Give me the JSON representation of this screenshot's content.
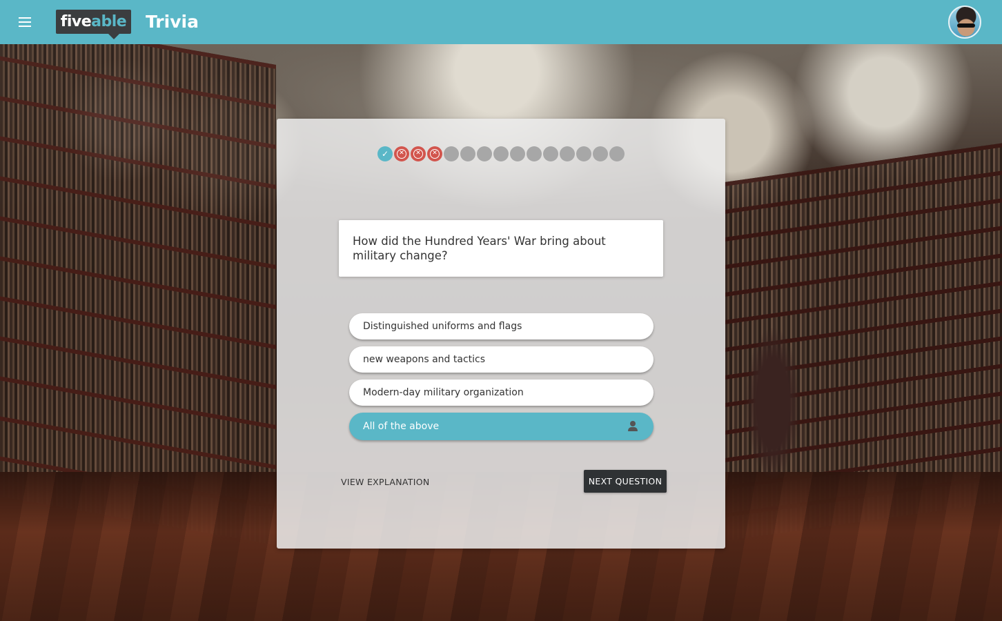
{
  "header": {
    "logo_part1": "five",
    "logo_part2": "able",
    "app_title": "Trivia",
    "bar_color": "#5ab7c7"
  },
  "progress": [
    {
      "state": "correct",
      "icon": "check-icon"
    },
    {
      "state": "wrong",
      "icon": "x-icon"
    },
    {
      "state": "wrong",
      "icon": "x-icon"
    },
    {
      "state": "wrong",
      "icon": "x-icon"
    },
    {
      "state": "pending"
    },
    {
      "state": "pending"
    },
    {
      "state": "pending"
    },
    {
      "state": "pending"
    },
    {
      "state": "pending"
    },
    {
      "state": "pending"
    },
    {
      "state": "pending"
    },
    {
      "state": "pending"
    },
    {
      "state": "pending"
    },
    {
      "state": "pending"
    },
    {
      "state": "pending"
    }
  ],
  "question": {
    "text": "How did the Hundred Years' War bring about military change?"
  },
  "answers": [
    {
      "label": "Distinguished uniforms and flags",
      "selected": false
    },
    {
      "label": "new weapons and tactics",
      "selected": false
    },
    {
      "label": "Modern-day military organization",
      "selected": false
    },
    {
      "label": "All of the above",
      "selected": true,
      "icon": "user-icon"
    }
  ],
  "actions": {
    "view_explanation": "VIEW EXPLANATION",
    "next_question": "NEXT QUESTION"
  },
  "colors": {
    "correct": "#5ab7c7",
    "wrong": "#d2554d",
    "pending": "#a7a7a7",
    "selected_answer": "#5ab7c7"
  }
}
